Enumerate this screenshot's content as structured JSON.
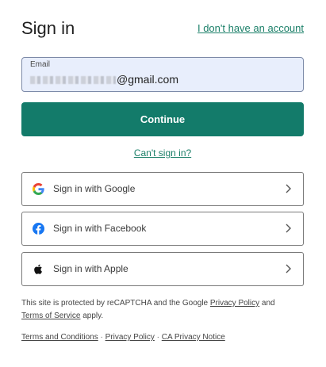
{
  "header": {
    "title": "Sign in",
    "no_account_link": "I don't have an account"
  },
  "email": {
    "label": "Email",
    "value_visible_suffix": "@gmail.com"
  },
  "continue_label": "Continue",
  "cant_sign_in_label": "Can't sign in?",
  "social": [
    {
      "label": "Sign in with Google",
      "icon": "google-icon"
    },
    {
      "label": "Sign in with Facebook",
      "icon": "facebook-icon"
    },
    {
      "label": "Sign in with Apple",
      "icon": "apple-icon"
    }
  ],
  "legal": {
    "prefix": "This site is protected by reCAPTCHA and the Google ",
    "privacy_policy": "Privacy Policy",
    "and": " and",
    "terms_of_service": "Terms of Service",
    "suffix": " apply."
  },
  "footer": {
    "terms": "Terms and Conditions",
    "separator": " · ",
    "privacy": "Privacy Policy",
    "ca_privacy": "CA Privacy Notice"
  },
  "colors": {
    "accent": "#137b6a",
    "link": "#1a7f68",
    "email_bg": "#e8eefc"
  }
}
